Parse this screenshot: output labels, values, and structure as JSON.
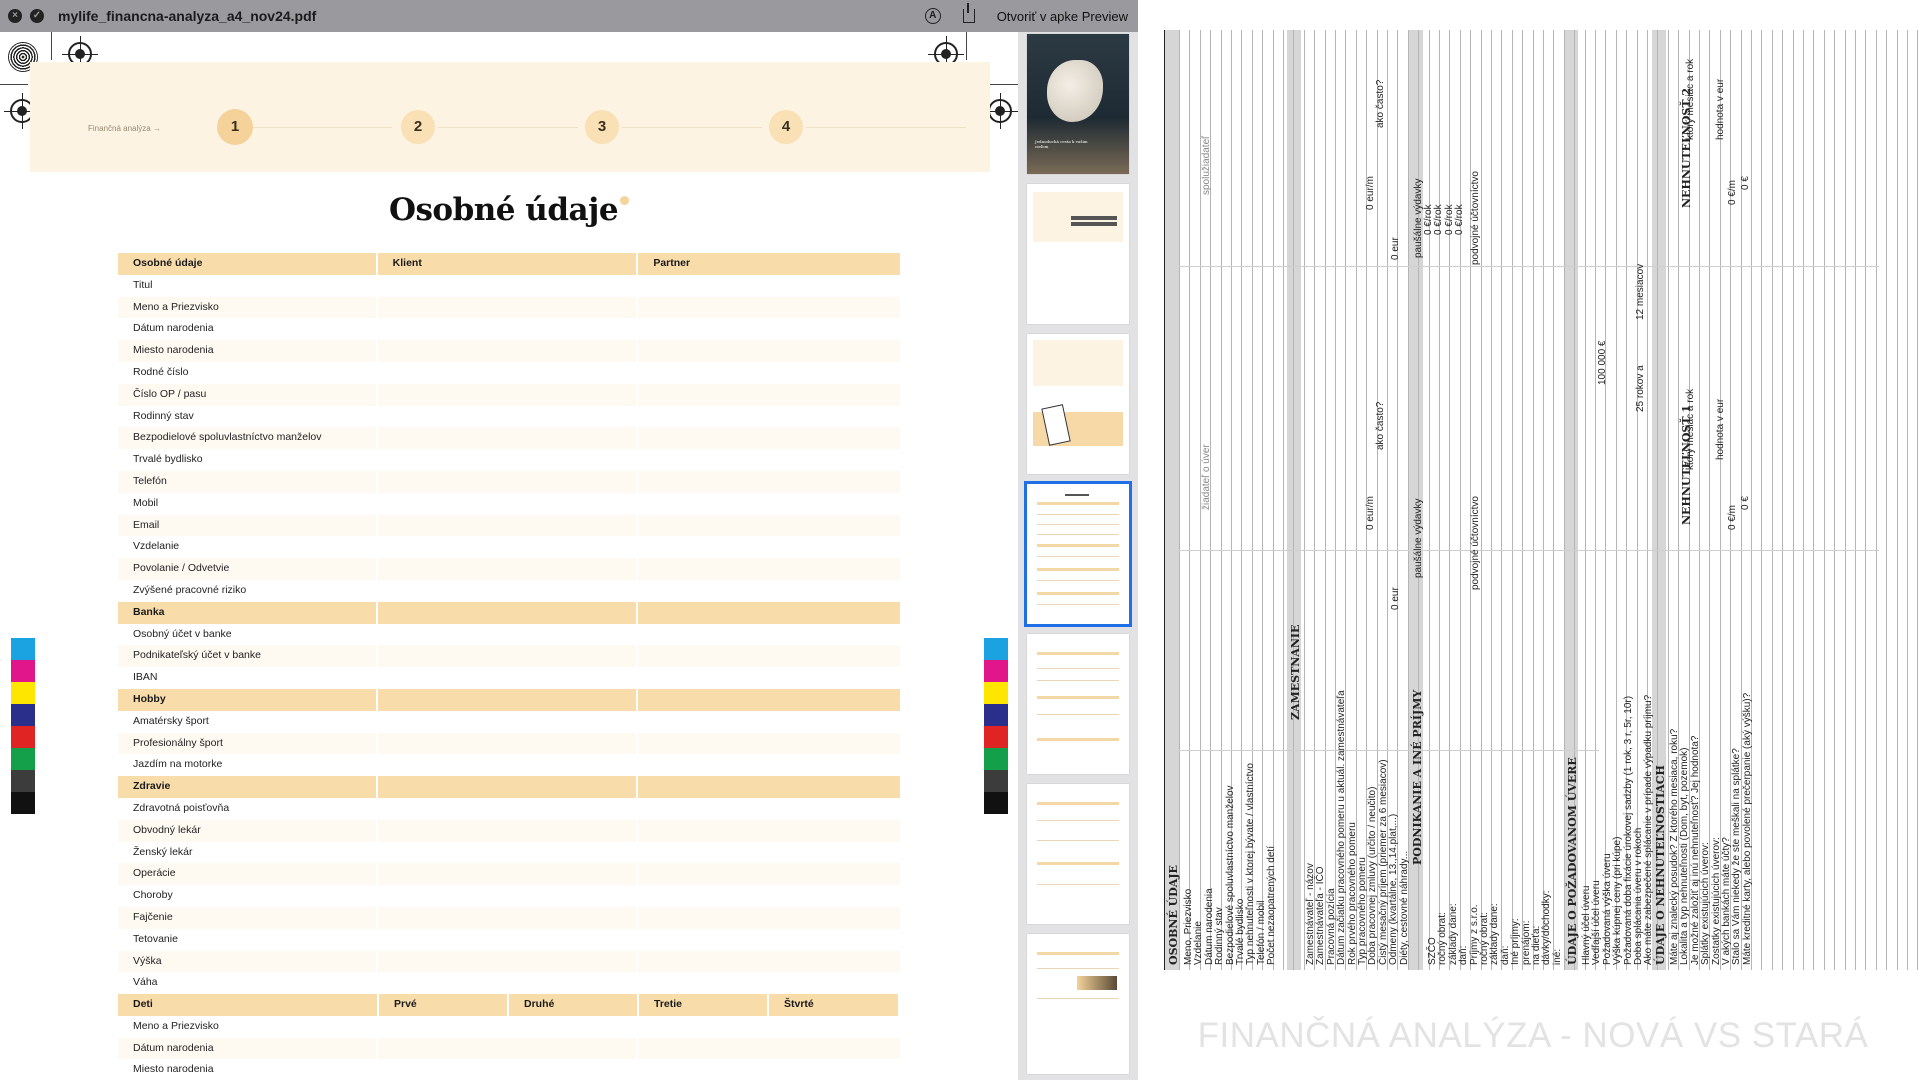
{
  "window": {
    "title": "mylife_financna-analyza_a4_nov24.pdf",
    "open_in_preview": "Otvoriť v apke Preview"
  },
  "page": {
    "steps_link": "Finančná analýza",
    "steps": [
      "1",
      "2",
      "3",
      "4"
    ],
    "active_step": "1",
    "title": "Osobné údaje",
    "table": {
      "header": [
        "Osobné údaje",
        "Klient",
        "Partner"
      ],
      "rows_personal": [
        "Titul",
        "Meno a Priezvisko",
        "Dátum narodenia",
        "Miesto narodenia",
        "Rodné číslo",
        "Číslo OP / pasu",
        "Rodinný stav",
        "Bezpodielové spoluvlastníctvo manželov",
        "Trvalé bydlisko",
        "Telefón",
        "Mobil",
        "Email",
        "Vzdelanie",
        "Povolanie / Odvetvie",
        "Zvýšené pracovné riziko"
      ],
      "section_bank": "Banka",
      "rows_bank": [
        "Osobný účet v banke",
        "Podnikateľský účet v banke",
        "IBAN"
      ],
      "section_hobby": "Hobby",
      "rows_hobby": [
        "Amatérsky šport",
        "Profesionálny šport",
        "Jazdím na motorke"
      ],
      "section_health": "Zdravie",
      "rows_health": [
        "Zdravotná poisťovňa",
        "Obvodný lekár",
        "Ženský lekár",
        "Operácie",
        "Choroby",
        "Fajčenie",
        "Tetovanie",
        "Výška",
        "Váha"
      ],
      "children_header": [
        "Deti",
        "Prvé",
        "Druhé",
        "Tretie",
        "Štvrté"
      ],
      "rows_children": [
        "Meno a Priezvisko",
        "Dátum narodenia",
        "Miesto narodenia"
      ]
    },
    "colors": {
      "header": "#f8dcaa",
      "band": "#fdf3e3",
      "step": "#f9e0b5",
      "selection": "#1f6fe6"
    }
  },
  "thumbnails": {
    "cover_text": "Jednoduchá cesta k vašim cieľom",
    "selected_index": 3
  },
  "right_doc": {
    "caption": "FINANČNÁ ANALÝZA - NOVÁ VS STARÁ",
    "sections": [
      "OSOBNÉ ÚDAJE",
      "ZAMESTNANIE",
      "PODNIKANIE A INÉ PRÍJMY",
      "ÚDAJE O POŽADOVANOM ÚVERE",
      "ÚDAJE O NEHNUTEĽNOSTIACH"
    ],
    "col_headers": [
      "žiadateľ o úver",
      "spolužiadateľ",
      "NEHNUTEĽNOSŤ 1",
      "NEHNUTEĽNOSŤ 2"
    ],
    "personal_rows": [
      "Meno, Priezvisko",
      "Vzdelanie",
      "Dátum narodenia",
      "Rodinný stav",
      "Bezpodielové spoluvlastníctvo manželov",
      "Trvalé bydlisko",
      "Typ nehnuteľnosti v ktorej bývate / vlastníctvo",
      "Telefón / mobil",
      "Počet nezaopatrených detí"
    ],
    "employment_rows": [
      "Zamestnávateľ - názov",
      "Zamestnávateľa - IČO",
      "Pracovná pozícia",
      "Dátum začiatku pracovného pomeru u aktuál. zamestnávateľa",
      "Rok prvého pracovného pomeru",
      "Typ pracovného pomeru",
      "Doba pracovnej zmluvy (určito / neučito)",
      "Čistý mesačný príjem (priemer za 6 mesiacov)",
      "Odmeny (kvartálne, 13.,14.plat,...)",
      "Diéty, cestovné náhrady..."
    ],
    "business_rows": [
      "SZČO",
      "ročný obrat:",
      "základy dane:",
      "daň:",
      "Príjmy z s.r.o.",
      "ročný obrat:",
      "základy dane:",
      "daň:",
      "Iné príjmy:",
      "prenájom:",
      "na dieťa:",
      "dávky/dôchodky:",
      "iné:"
    ],
    "loan_rows": [
      "Hlavný účel úveru",
      "Vedľajší účel úveru",
      "Požadovaná výška úveru",
      "Výška kúpnej ceny (pri kúpe)",
      "Požadovaná doba fixácie úrokovej sadzby (1 rok, 3 r, 5r, 10r)",
      "Doba splácania úveru v rokoch",
      "Ako máte zabezpečené splácanie v prípade výpadku príjmu?"
    ],
    "property_rows": [
      "Máte aj znalecký posudok? Z ktorého mesiaca, roku?",
      "Lokalita a typ nehnuteľnosti (Dom, byt, pozemok)",
      "Je možné založiť aj inú nehnuteľnosť? Jej hodnota?",
      "Splátky existujúcich úverov:",
      "Zostatky existujúcich úverov:",
      "V akých bankách máte účty?",
      "Stalo sa Vám niekedy že ste meškali na splátke?",
      "Máte kreditné karty, alebo povolené prečerpanie (aký výšku)?"
    ],
    "values": {
      "eur1": "0 eur",
      "eurm1": "0 eur/m",
      "how_often": "ako často?",
      "pausal": "paušálne výdavky",
      "per_year": "0 €/rok",
      "double": "podvojné účtovníctvo",
      "loan_amount": "100 000 €",
      "years": "25 rokov a",
      "months": "12 mesiacov",
      "which_month": "ktorý mesiac a rok",
      "value_eur": "hodnota v eur",
      "zero_em": "0 €/m",
      "zero_e": "0 €"
    }
  }
}
